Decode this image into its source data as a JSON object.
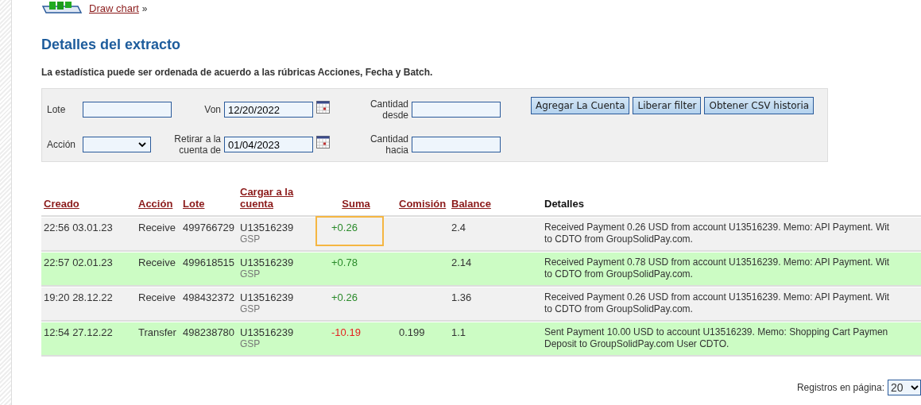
{
  "chart_link": {
    "label": "Draw chart",
    "suffix": "»"
  },
  "title": "Detalles del extracto",
  "note": "La estadística puede ser ordenada de acuerdo a las rúbricas Acciones, Fecha y Batch.",
  "filters": [
    {
      "kind": "text",
      "label": "Lote"
    },
    {
      "kind": "date",
      "label": "Von",
      "value": "12/20/2022"
    },
    {
      "kind": "text",
      "label": "Cantidad desde"
    },
    {
      "kind": "select",
      "label": "Acción"
    },
    {
      "kind": "date",
      "label": "Retirar a la cuenta de",
      "value": "01/04/2023"
    },
    {
      "kind": "text",
      "label": "Cantidad hacia"
    }
  ],
  "buttons": [
    "Agregar La Cuenta",
    "Liberar filter",
    "Obtener CSV historia"
  ],
  "table": {
    "columns": [
      {
        "label": "Creado",
        "sortable": true
      },
      {
        "label": "Acción",
        "sortable": true
      },
      {
        "label": "Lote",
        "sortable": true
      },
      {
        "label": "Cargar a la cuenta",
        "sortable": true
      },
      {
        "label": "Suma",
        "sortable": true
      },
      {
        "label": "Comisión",
        "sortable": true
      },
      {
        "label": "Balance",
        "sortable": true
      },
      {
        "label": "Detalles",
        "sortable": false
      }
    ],
    "rows": [
      {
        "created": "22:56 03.01.23",
        "action": "Receive",
        "batch": "499766729",
        "account": "U13516239",
        "account_sub": "GSP",
        "amount": "+0.26",
        "negative": false,
        "highlighted": true,
        "fee": "",
        "balance": "2.4",
        "details": [
          "Received Payment 0.26 USD from account U13516239. Memo: API Payment. Wit",
          "to CDTO from GroupSolidPay.com."
        ]
      },
      {
        "created": "22:57 02.01.23",
        "action": "Receive",
        "batch": "499618515",
        "account": "U13516239",
        "account_sub": "GSP",
        "amount": "+0.78",
        "negative": false,
        "highlighted": false,
        "fee": "",
        "balance": "2.14",
        "details": [
          "Received Payment 0.78 USD from account U13516239. Memo: API Payment. Wit",
          "to CDTO from GroupSolidPay.com."
        ]
      },
      {
        "created": "19:20 28.12.22",
        "action": "Receive",
        "batch": "498432372",
        "account": "U13516239",
        "account_sub": "GSP",
        "amount": "+0.26",
        "negative": false,
        "highlighted": false,
        "fee": "",
        "balance": "1.36",
        "details": [
          "Received Payment 0.26 USD from account U13516239. Memo: API Payment. Wit",
          "to CDTO from GroupSolidPay.com."
        ]
      },
      {
        "created": "12:54 27.12.22",
        "action": "Transfer",
        "batch": "498238780",
        "account": "U13516239",
        "account_sub": "GSP",
        "amount": "-10.19",
        "negative": true,
        "highlighted": false,
        "fee": "0.199",
        "balance": "1.1",
        "details": [
          "Sent Payment 10.00 USD to account U13516239. Memo: Shopping Cart Paymen",
          "Deposit to GroupSolidPay.com User CDTO."
        ]
      }
    ]
  },
  "page_size": {
    "label": "Registros en página:",
    "value": "20"
  }
}
